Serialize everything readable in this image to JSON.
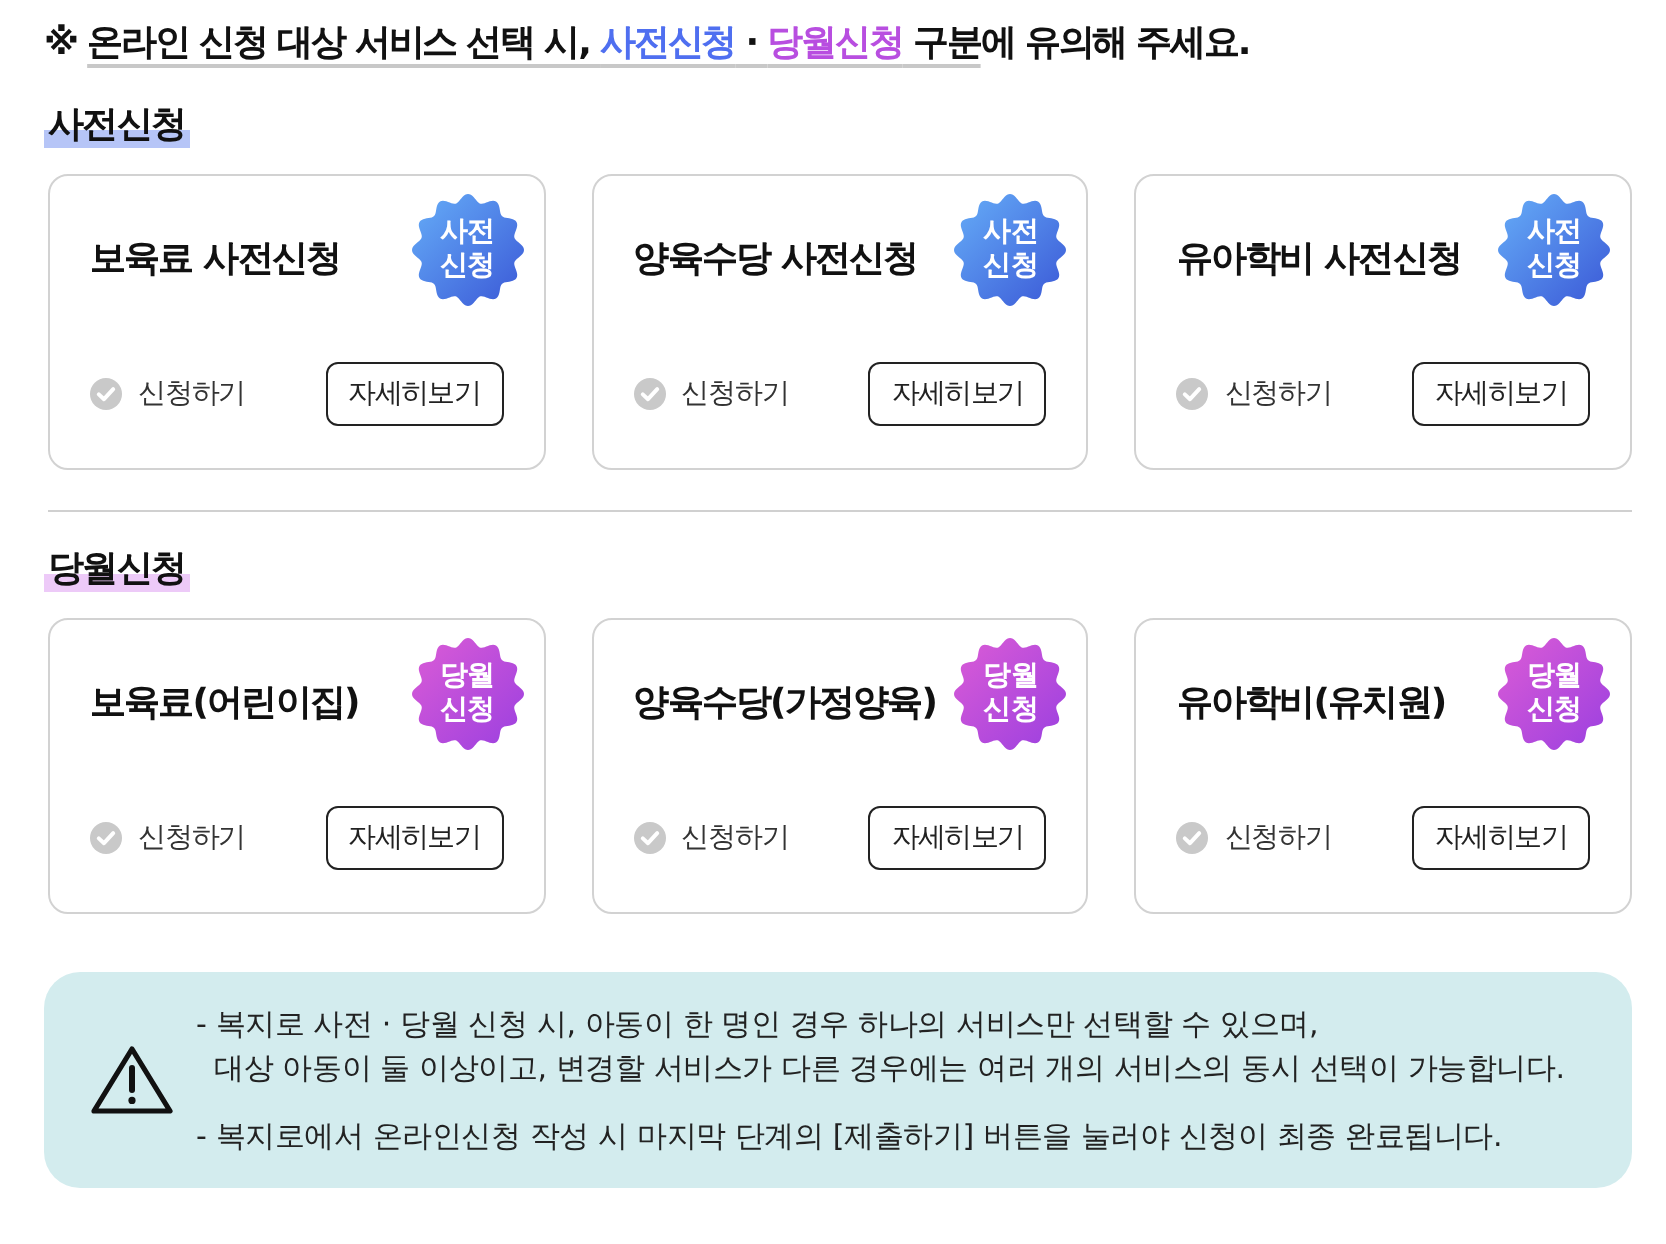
{
  "notice": {
    "segments": [
      {
        "text": "※ ",
        "kind": "plain",
        "underlined": false
      },
      {
        "text": "온라인 신청 대상 서비스 선택 시, ",
        "kind": "plain",
        "underlined": true
      },
      {
        "text": "사전신청",
        "kind": "pre",
        "underlined": true
      },
      {
        "text": " · ",
        "kind": "plain",
        "underlined": true
      },
      {
        "text": "당월신청",
        "kind": "monthly",
        "underlined": true
      },
      {
        "text": " 구분",
        "kind": "plain",
        "underlined": true
      },
      {
        "text": "에 유의해 주세요.",
        "kind": "plain",
        "underlined": false
      }
    ]
  },
  "sections": [
    {
      "heading": "사전신청",
      "kind": "pre",
      "cards": [
        {
          "title": "보육료 사전신청",
          "badge": "사전\n신청",
          "apply_label": "신청하기",
          "checked": false,
          "button": "자세히보기"
        },
        {
          "title": "양육수당 사전신청",
          "badge": "사전\n신청",
          "apply_label": "신청하기",
          "checked": false,
          "button": "자세히보기"
        },
        {
          "title": "유아학비 사전신청",
          "badge": "사전\n신청",
          "apply_label": "신청하기",
          "checked": false,
          "button": "자세히보기"
        }
      ]
    },
    {
      "heading": "당월신청",
      "kind": "monthly",
      "cards": [
        {
          "title": "보육료(어린이집)",
          "badge": "당월\n신청",
          "apply_label": "신청하기",
          "checked": false,
          "button": "자세히보기"
        },
        {
          "title": "양육수당(가정양육)",
          "badge": "당월\n신청",
          "apply_label": "신청하기",
          "checked": false,
          "button": "자세히보기"
        },
        {
          "title": "유아학비(유치원)",
          "badge": "당월\n신청",
          "apply_label": "신청하기",
          "checked": false,
          "button": "자세히보기"
        }
      ]
    }
  ],
  "info": {
    "notes": [
      "- 복지로 사전 · 당월 신청 시, 아동이 한 명인 경우 하나의 서비스만 선택할 수 있으며,\n대상 아동이 둘 이상이고, 변경할 서비스가 다른 경우에는 여러 개의 서비스의 동시 선택이 가능합니다.",
      "- 복지로에서 온라인신청 작성 시 마지막 단계의 [제출하기] 버튼을 눌러야 신청이 최종 완료됩니다."
    ]
  }
}
